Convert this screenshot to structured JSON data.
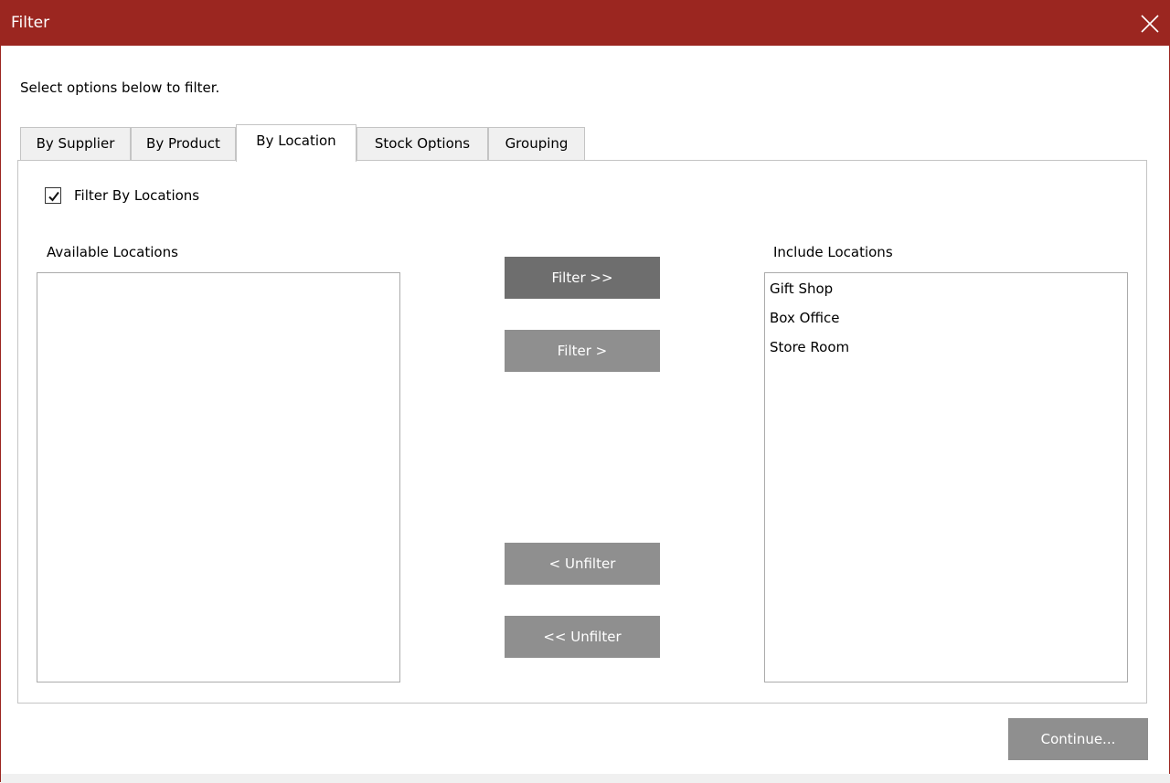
{
  "window": {
    "title": "Filter",
    "accent_color": "#9b2620"
  },
  "instruction": "Select options below to filter.",
  "tabs": [
    {
      "label": "By Supplier",
      "active": false
    },
    {
      "label": "By Product",
      "active": false
    },
    {
      "label": "By Location",
      "active": true
    },
    {
      "label": "Stock Options",
      "active": false
    },
    {
      "label": "Grouping",
      "active": false
    }
  ],
  "filter_checkbox": {
    "label": "Filter By Locations",
    "checked": true
  },
  "available": {
    "label": "Available Locations",
    "items": []
  },
  "included": {
    "label": "Include Locations",
    "items": [
      "Gift Shop",
      "Box Office",
      "Store Room"
    ]
  },
  "buttons": {
    "filter_all": "Filter >>",
    "filter_one": "Filter >",
    "unfilter_one": "< Unfilter",
    "unfilter_all": "<< Unfilter",
    "continue": "Continue..."
  }
}
